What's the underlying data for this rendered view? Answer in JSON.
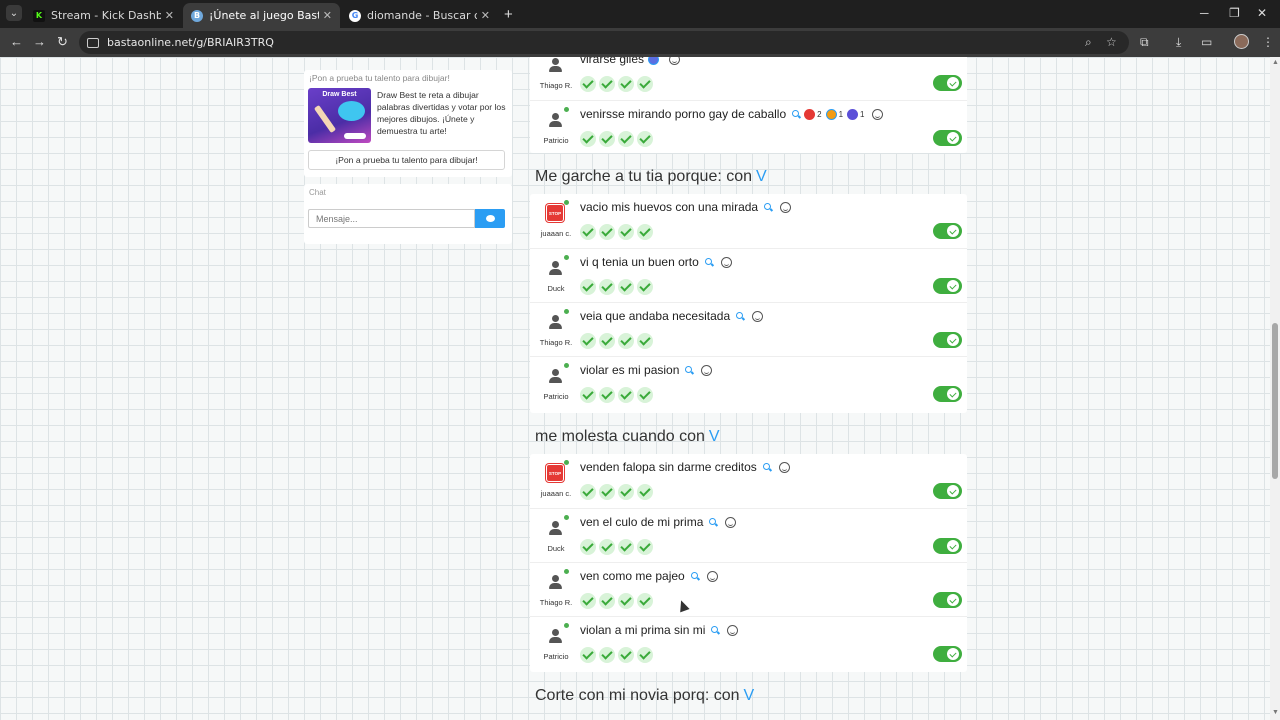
{
  "browser": {
    "tabs": [
      {
        "title": "Stream - Kick Dashboard",
        "favicon": "kick-icon",
        "color": "#53fc18"
      },
      {
        "title": "¡Únete al juego Basta!",
        "favicon": "basta-icon",
        "color": "#6fa8dc"
      },
      {
        "title": "diomande - Buscar con Google",
        "favicon": "google-icon",
        "color": "#ffffff"
      }
    ],
    "url": "bastaonline.net/g/BRIAIR3TRQ"
  },
  "sidebar": {
    "promo_heading": "¡Pon a prueba tu talento para dibujar!",
    "promo_image_label": "Draw Best",
    "promo_text": "Draw Best te reta a dibujar palabras divertidas y votar por los mejores dibujos. ¡Únete y demuestra tu arte!",
    "promo_button": "¡Pon a prueba tu talento para dibujar!",
    "chat_heading": "Chat",
    "chat_placeholder": "Mensaje..."
  },
  "main": {
    "top_card": [
      {
        "user": "Thiago R.",
        "answer": "virarse giles",
        "avatar": "user"
      },
      {
        "user": "Patricio",
        "answer": "venirsse mirando porno gay de caballo",
        "avatar": "user",
        "reactions": [
          {
            "icon": "heart-icon",
            "count": "2"
          },
          {
            "icon": "angry-icon",
            "count": "1"
          },
          {
            "icon": "thumbs-up-icon",
            "count": "1"
          }
        ]
      }
    ],
    "categories": [
      {
        "title": "Me garche a tu tia porque: con",
        "letter": "V",
        "answers": [
          {
            "user": "juaaan c.",
            "answer": "vacio mis huevos con una mirada",
            "avatar": "stop"
          },
          {
            "user": "Duck",
            "answer": "vi q tenia un buen orto",
            "avatar": "user"
          },
          {
            "user": "Thiago R.",
            "answer": "veia que andaba necesitada",
            "avatar": "user"
          },
          {
            "user": "Patricio",
            "answer": "violar es mi pasion",
            "avatar": "user"
          }
        ]
      },
      {
        "title": "me molesta cuando con",
        "letter": "V",
        "answers": [
          {
            "user": "juaaan c.",
            "answer": "venden falopa sin darme creditos",
            "avatar": "stop"
          },
          {
            "user": "Duck",
            "answer": "ven el culo de mi prima",
            "avatar": "user"
          },
          {
            "user": "Thiago R.",
            "answer": "ven como me pajeo",
            "avatar": "user"
          },
          {
            "user": "Patricio",
            "answer": "violan a mi prima sin mi",
            "avatar": "user"
          }
        ]
      },
      {
        "title": "Corte con mi novia porq: con",
        "letter": "V",
        "answers": []
      }
    ],
    "stop_badge": "STOP",
    "vote_count": 4,
    "accent": "#2b9df3",
    "approve_color": "#3fae3f"
  }
}
